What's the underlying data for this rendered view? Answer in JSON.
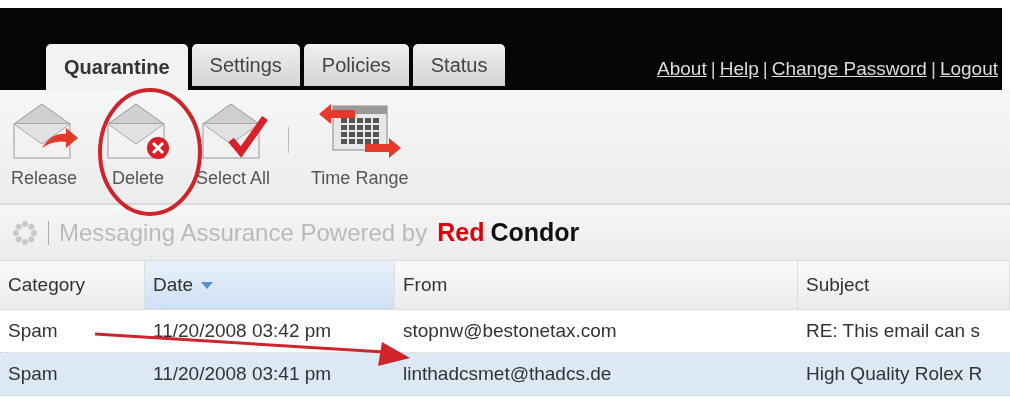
{
  "tabs": [
    {
      "label": "Quarantine",
      "selected": true
    },
    {
      "label": "Settings",
      "selected": false
    },
    {
      "label": "Policies",
      "selected": false
    },
    {
      "label": "Status",
      "selected": false
    }
  ],
  "links": [
    {
      "label": "About"
    },
    {
      "label": "Help"
    },
    {
      "label": "Change Password"
    },
    {
      "label": "Logout"
    }
  ],
  "link_separator": "|",
  "toolbar": [
    {
      "label": "Release",
      "kind": "release"
    },
    {
      "label": "Delete",
      "kind": "delete"
    },
    {
      "label": "Select All",
      "kind": "select"
    },
    {
      "label": "Time Range",
      "kind": "time"
    }
  ],
  "brand": {
    "tagline": "Messaging Assurance Powered by",
    "logo_words": [
      "Red",
      "Condor"
    ]
  },
  "table": {
    "columns": [
      {
        "label": "Category",
        "sorted": false
      },
      {
        "label": "Date",
        "sorted": true
      },
      {
        "label": "From",
        "sorted": false
      },
      {
        "label": "Subject",
        "sorted": false
      }
    ],
    "rows": [
      {
        "cells": [
          "Spam",
          "11/20/2008 03:42 pm",
          "stopnw@bestonetax.com",
          "RE: This email can s"
        ],
        "selected": false
      },
      {
        "cells": [
          "Spam",
          "11/20/2008 03:41 pm",
          "linthadcsmet@thadcs.de",
          "High Quality Rolex R"
        ],
        "selected": true
      }
    ]
  }
}
